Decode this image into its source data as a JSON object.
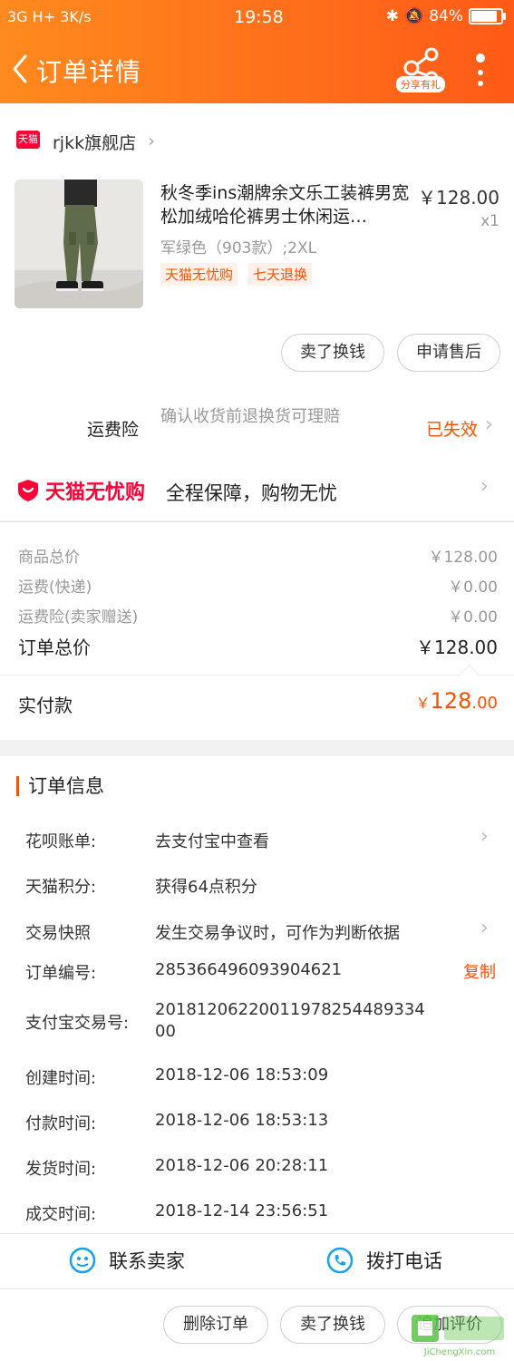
{
  "status_bar": {
    "left": "3G  H+  3K/s",
    "time": "19:58",
    "battery": "84%",
    "battery_level": 0.84
  },
  "nav": {
    "title": "订单详情",
    "share_label": "分享有礼"
  },
  "shop": {
    "badge": "天猫",
    "name": "rjkk旗舰店"
  },
  "product": {
    "title": "秋冬季ins潮牌余文乐工装裤男宽松加绒哈伦裤男士休闲运…",
    "price": "￥128.00",
    "qty": "x1",
    "sku": "军绿色（903款）;2XL",
    "tags": [
      "天猫无忧购",
      "七天退换"
    ]
  },
  "item_actions": {
    "sell": "卖了换钱",
    "after_sale": "申请售后"
  },
  "insurance": {
    "label": "运费险",
    "desc": "确认收货前退换货可理赔",
    "status": "已失效"
  },
  "guarantee": {
    "logo_text": "天猫无忧购",
    "desc": "全程保障，购物无忧"
  },
  "summary": {
    "rows": [
      {
        "label": "商品总价",
        "value": "￥128.00"
      },
      {
        "label": "运费(快递)",
        "value": "￥0.00"
      },
      {
        "label": "运费险(卖家赠送)",
        "value": "￥0.00"
      }
    ],
    "total_label": "订单总价",
    "total_value": "￥128.00",
    "paid_label": "实付款",
    "paid_currency": "￥",
    "paid_int": "128",
    "paid_dec": ".00"
  },
  "order_info": {
    "heading": "订单信息",
    "rows": [
      {
        "label": "花呗账单:",
        "value": "去支付宝中查看"
      },
      {
        "label": "天猫积分:",
        "value": "获得64点积分"
      },
      {
        "label": "交易快照",
        "value": "发生交易争议时，可作为判断依据"
      },
      {
        "label": "订单编号:",
        "value": "285366496093904621"
      },
      {
        "label": "支付宝交易号:",
        "value": "2018120622001197825448933400"
      },
      {
        "label": "创建时间:",
        "value": "2018-12-06 18:53:09"
      },
      {
        "label": "付款时间:",
        "value": "2018-12-06 18:53:13"
      },
      {
        "label": "发货时间:",
        "value": "2018-12-06 20:28:11"
      },
      {
        "label": "成交时间:",
        "value": "2018-12-14 23:56:51"
      }
    ],
    "copy_label": "复制"
  },
  "contact": {
    "seller": "联系卖家",
    "phone": "拨打电话"
  },
  "bottom_actions": {
    "delete": "删除订单",
    "sell": "卖了换钱",
    "review": "追加评价"
  },
  "watermark": {
    "url": "JiChengXin.com"
  }
}
